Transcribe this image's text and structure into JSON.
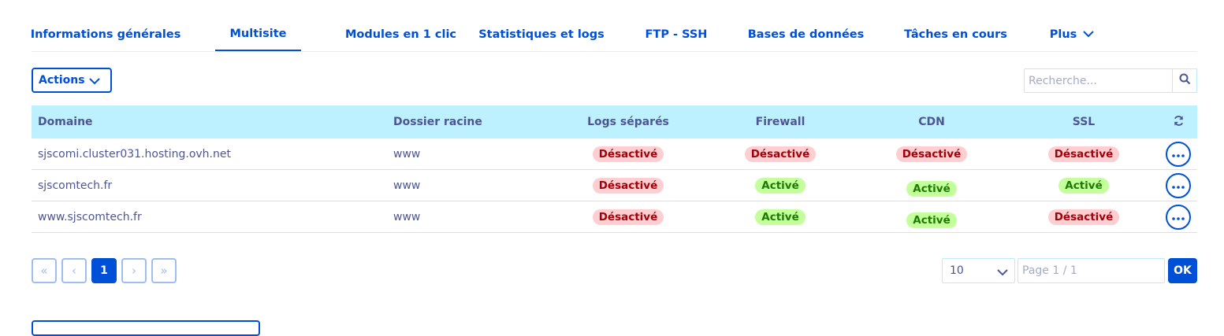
{
  "tabs": [
    {
      "label": "Informations générales",
      "active": false
    },
    {
      "label": "Multisite",
      "active": true
    },
    {
      "label": "Modules en 1 clic",
      "active": false
    },
    {
      "label": "Statistiques et logs",
      "active": false
    },
    {
      "label": "FTP - SSH",
      "active": false
    },
    {
      "label": "Bases de données",
      "active": false
    },
    {
      "label": "Tâches en cours",
      "active": false
    },
    {
      "label": "Plus",
      "active": false,
      "icon": "chevron-down-icon"
    }
  ],
  "toolbar": {
    "actions_label": "Actions",
    "search_placeholder": "Recherche..."
  },
  "table": {
    "columns": [
      "Domaine",
      "Dossier racine",
      "Logs séparés",
      "Firewall",
      "CDN",
      "SSL"
    ],
    "refresh_icon": "refresh-icon",
    "rows": [
      {
        "domain": "sjscomi.cluster031.hosting.ovh.net",
        "root": "www",
        "logs": "Désactivé",
        "firewall": "Désactivé",
        "cdn": "Désactivé",
        "ssl": "Désactivé"
      },
      {
        "domain": "sjscomtech.fr",
        "root": "www",
        "logs": "Désactivé",
        "firewall": "Activé",
        "cdn": "Activé",
        "ssl": "Activé"
      },
      {
        "domain": "www.sjscomtech.fr",
        "root": "www",
        "logs": "Désactivé",
        "firewall": "Activé",
        "cdn": "Activé",
        "ssl": "Désactivé"
      }
    ]
  },
  "pagination": {
    "first": "«",
    "prev": "‹",
    "current": "1",
    "next": "›",
    "last": "»",
    "page_size": "10",
    "page_placeholder": "Page 1 / 1",
    "ok_label": "OK"
  },
  "colors": {
    "primary": "#0050d7",
    "header_bg": "#bef1ff",
    "badge_off_bg": "#ffced1",
    "badge_on_bg": "#c3ff9a"
  }
}
